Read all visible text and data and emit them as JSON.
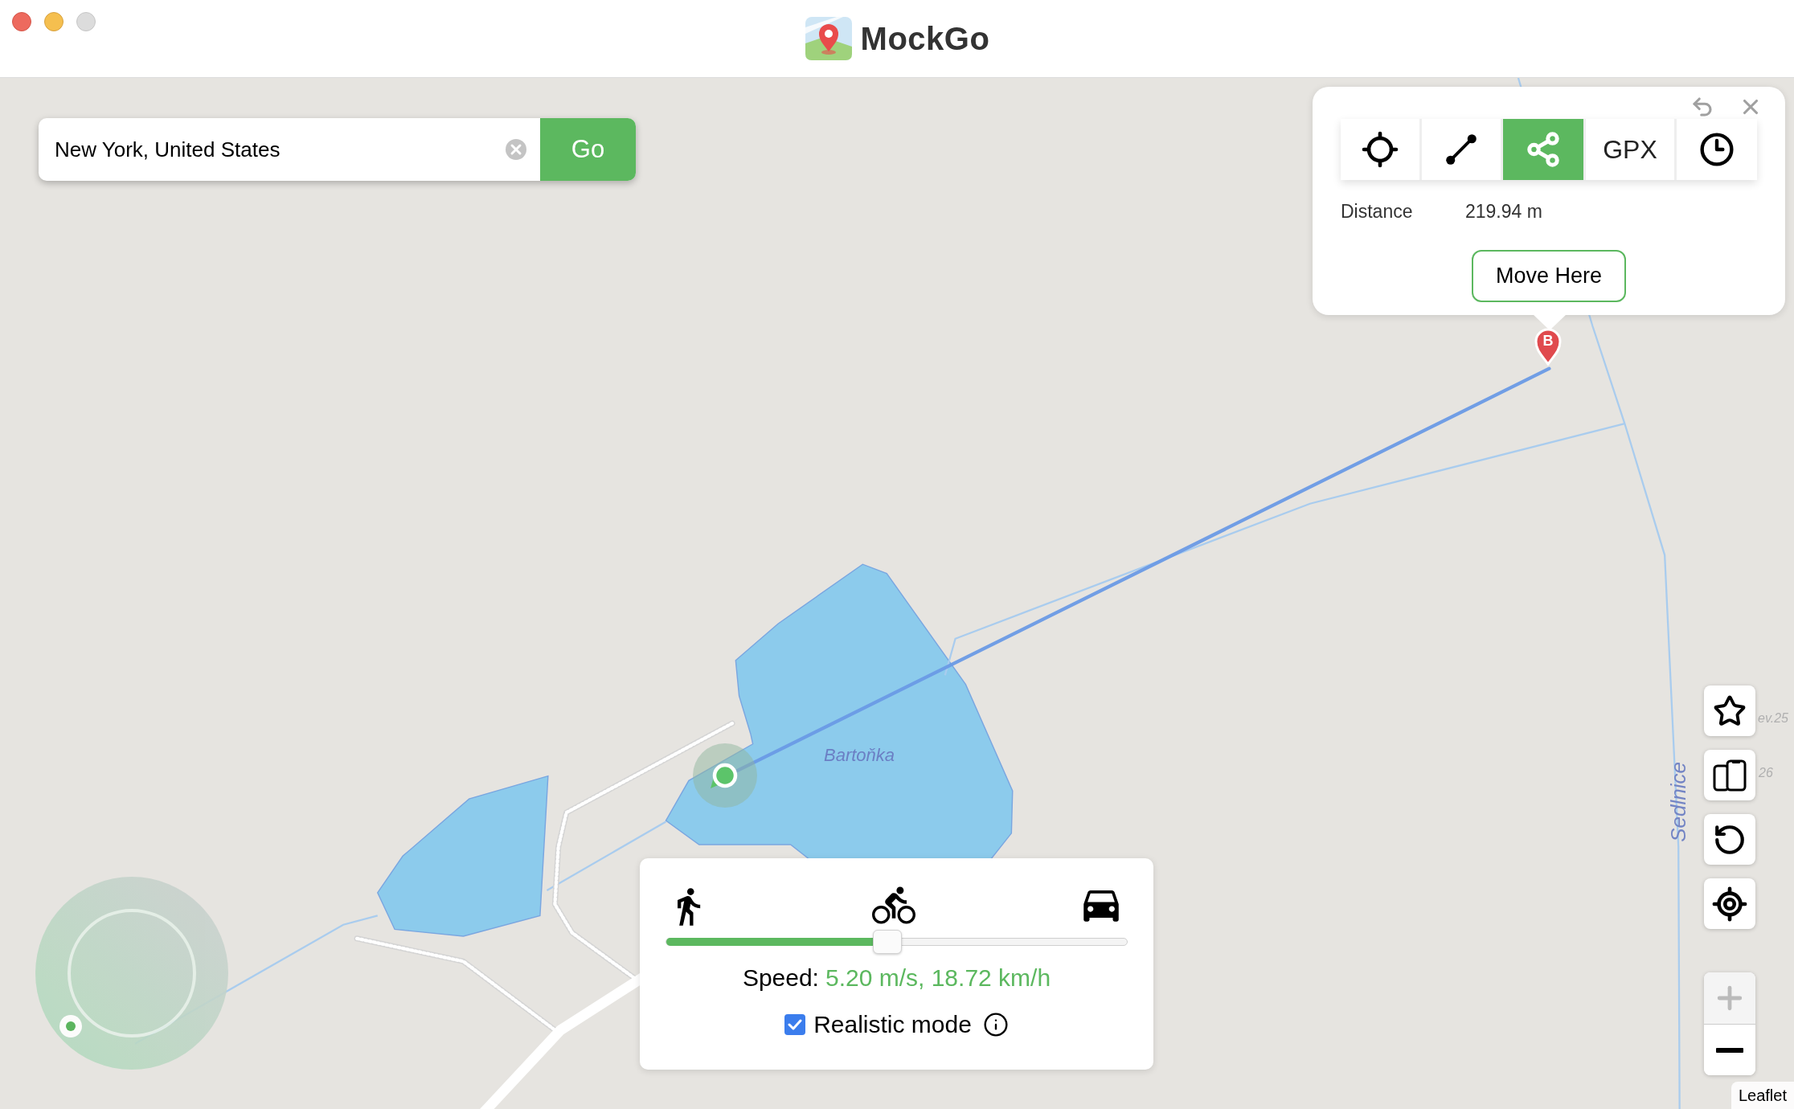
{
  "window": {
    "traffic_lights": [
      {
        "kind": "close",
        "disabled": false
      },
      {
        "kind": "minimize",
        "disabled": false
      },
      {
        "kind": "zoom",
        "disabled": true
      }
    ],
    "title": "MockGo"
  },
  "search": {
    "value": "New York, United States",
    "button": "Go"
  },
  "route_popup": {
    "tools": [
      {
        "kind": "teleport",
        "selected": false
      },
      {
        "kind": "two_spot",
        "selected": false
      },
      {
        "kind": "multi_spot",
        "selected": true
      },
      {
        "kind": "gpx",
        "label": "GPX",
        "selected": false
      },
      {
        "kind": "history",
        "selected": false
      }
    ],
    "distance_label": "Distance",
    "distance_value": "219.94 m",
    "button": "Move Here"
  },
  "map": {
    "marker_label": "B",
    "labels": [
      {
        "kind": "water",
        "text": "Bartoňka"
      },
      {
        "kind": "stream",
        "text": "Sedlnice"
      },
      {
        "kind": "house_number",
        "text": "ev.25"
      },
      {
        "kind": "house_number",
        "text": "26"
      }
    ]
  },
  "zoom_controls": [
    {
      "kind": "in",
      "disabled": true
    },
    {
      "kind": "out",
      "disabled": false
    }
  ],
  "speed_panel": {
    "level": 0.48,
    "label": "Speed:",
    "reading": "5.20 m/s, 18.72 km/h",
    "realistic_mode": {
      "label": "Realistic mode",
      "checked": true
    }
  },
  "attribution": "Leaflet"
}
